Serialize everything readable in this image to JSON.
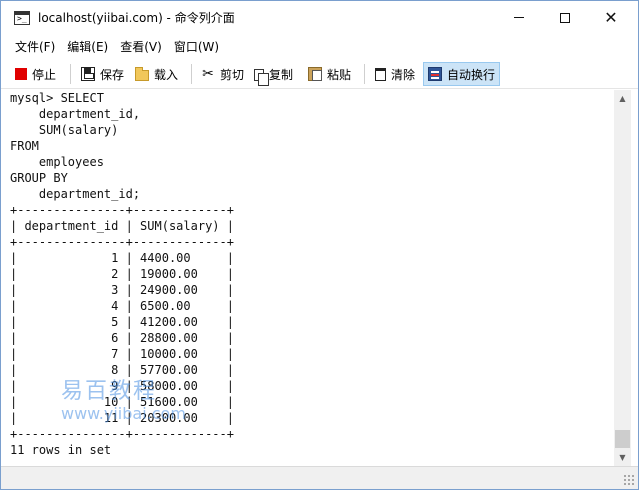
{
  "window": {
    "title": "localhost(yiibai.com) - 命令列介面",
    "controls": {
      "minimize": "",
      "maximize": "",
      "close": "✕"
    }
  },
  "menu": {
    "items": [
      "文件(F)",
      "编辑(E)",
      "查看(V)",
      "窗口(W)"
    ]
  },
  "toolbar": {
    "stop": "停止",
    "save": "保存",
    "load": "载入",
    "cut": "剪切",
    "copy": "复制",
    "paste": "粘贴",
    "clear": "清除",
    "word_wrap": "自动换行",
    "word_wrap_active": true
  },
  "console": {
    "lines": [
      "mysql> SELECT",
      "    department_id,",
      "    SUM(salary)",
      "FROM",
      "    employees",
      "GROUP BY",
      "    department_id;",
      "+---------------+-------------+",
      "| department_id | SUM(salary) |",
      "+---------------+-------------+",
      "|             1 | 4400.00     |",
      "|             2 | 19000.00    |",
      "|             3 | 24900.00    |",
      "|             4 | 6500.00     |",
      "|             5 | 41200.00    |",
      "|             6 | 28800.00    |",
      "|             7 | 10000.00    |",
      "|             8 | 57700.00    |",
      "|             9 | 58000.00    |",
      "|            10 | 51600.00    |",
      "|            11 | 20300.00    |",
      "+---------------+-------------+",
      "11 rows in set"
    ]
  },
  "scrollbar": {
    "up_arrow": "▲",
    "down_arrow": "▼",
    "position": 0.95
  },
  "watermark": {
    "text": "易百教程",
    "url": "www.yiibai.com"
  },
  "colors": {
    "stop_icon": "#e00000",
    "active_button_bg": "#cce4f7",
    "watermark": "#4a90e2"
  }
}
